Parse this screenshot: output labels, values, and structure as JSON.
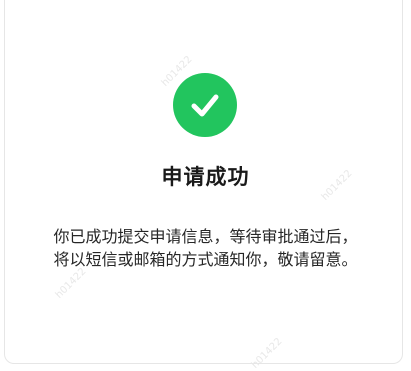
{
  "dialog": {
    "icon": "check-circle-icon",
    "accent_color": "#22c55e",
    "title": "申请成功",
    "message_lines": [
      "你已成功提交申请信息，等待审批通过后，",
      "将以短信或邮箱的方式通知你，敬请留意。"
    ]
  },
  "watermark": {
    "text": "h01422"
  }
}
